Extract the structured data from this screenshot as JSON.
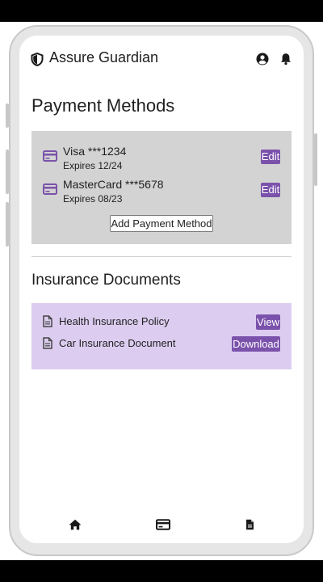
{
  "app": {
    "title": "Assure Guardian",
    "brand_icon": "shield-icon",
    "header_icons": [
      "account-circle-icon",
      "bell-icon"
    ]
  },
  "payment": {
    "title": "Payment Methods",
    "methods": [
      {
        "name": "Visa ***1234",
        "expiry": "Expires 12/24",
        "icon": "credit-card-icon",
        "action": "Edit"
      },
      {
        "name": "MasterCard ***5678",
        "expiry": "Expires 08/23",
        "icon": "credit-card-icon",
        "action": "Edit"
      }
    ],
    "add_label": "Add Payment Method"
  },
  "insurance": {
    "title": "Insurance Documents",
    "documents": [
      {
        "name": "Health Insurance Policy",
        "icon": "document-icon",
        "action": "View"
      },
      {
        "name": "Car Insurance Document",
        "icon": "document-icon",
        "action": "Download"
      }
    ]
  },
  "nav": {
    "items": [
      {
        "icon": "home-icon"
      },
      {
        "icon": "credit-card-icon"
      },
      {
        "icon": "document-icon"
      }
    ]
  },
  "colors": {
    "accent": "#7b52ab",
    "payment_card_bg": "#d3d3d3",
    "documents_card_bg": "#dccdf0"
  }
}
